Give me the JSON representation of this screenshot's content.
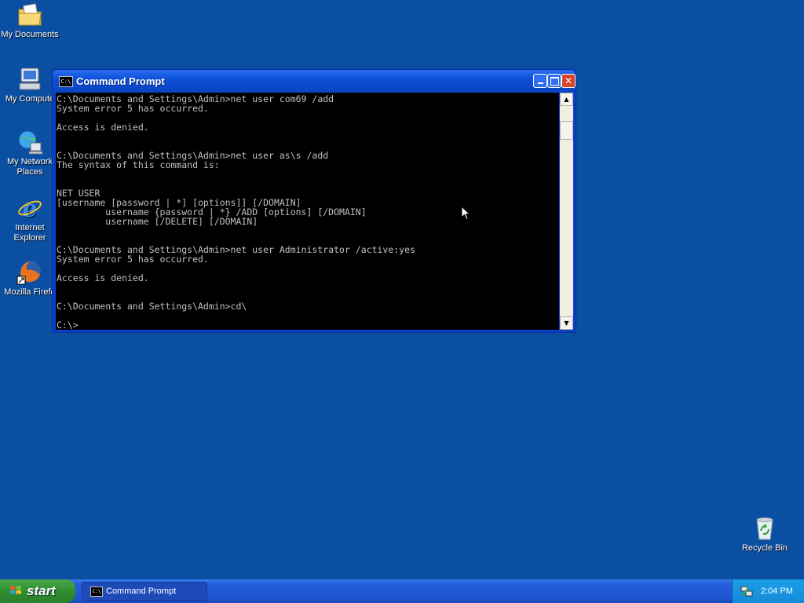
{
  "desktop": {
    "icons": [
      {
        "label": "My Documents",
        "icon": "folder-documents-icon"
      },
      {
        "label": "My Compute",
        "icon": "my-computer-icon"
      },
      {
        "label": "My Network Places",
        "icon": "network-places-icon"
      },
      {
        "label": "Internet Explorer",
        "icon": "internet-explorer-icon"
      },
      {
        "label": "Mozilla Firefo",
        "icon": "firefox-icon"
      },
      {
        "label": "Recycle Bin",
        "icon": "recycle-bin-icon"
      }
    ],
    "background_color": "#0b4fa2"
  },
  "window": {
    "title": "Command Prompt",
    "icon_text": "C:\\",
    "console_lines": [
      "C:\\Documents and Settings\\Admin>net user com69 /add",
      "System error 5 has occurred.",
      "",
      "Access is denied.",
      "",
      "",
      "C:\\Documents and Settings\\Admin>net user as\\s /add",
      "The syntax of this command is:",
      "",
      "",
      "NET USER",
      "[username [password | *] [options]] [/DOMAIN]",
      "         username {password | *} /ADD [options] [/DOMAIN]",
      "         username [/DELETE] [/DOMAIN]",
      "",
      "",
      "C:\\Documents and Settings\\Admin>net user Administrator /active:yes",
      "System error 5 has occurred.",
      "",
      "Access is denied.",
      "",
      "",
      "C:\\Documents and Settings\\Admin>cd\\",
      "",
      "C:\\>"
    ]
  },
  "taskbar": {
    "start_label": "start",
    "tasks": [
      {
        "label": "Command Prompt",
        "icon_text": "C:\\"
      }
    ],
    "clock": "2:04 PM"
  }
}
